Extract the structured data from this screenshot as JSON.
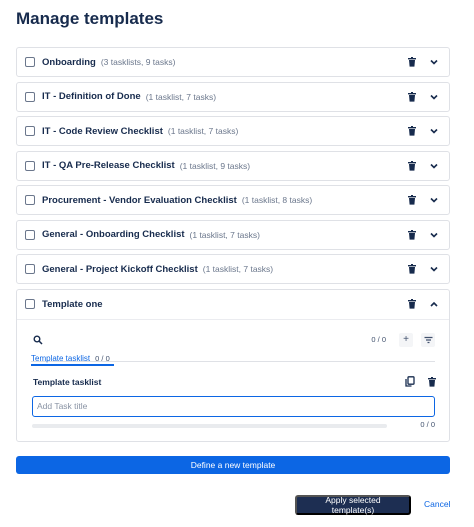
{
  "dialog": {
    "title": "Manage templates"
  },
  "templates": [
    {
      "name": "Onboarding",
      "meta": "(3 tasklists, 9 tasks)"
    },
    {
      "name": "IT - Definition of Done",
      "meta": "(1 tasklist, 7 tasks)"
    },
    {
      "name": "IT - Code Review Checklist",
      "meta": "(1 tasklist, 7 tasks)"
    },
    {
      "name": "IT - QA Pre-Release Checklist",
      "meta": "(1 tasklist, 9 tasks)"
    },
    {
      "name": "Procurement - Vendor Evaluation Checklist",
      "meta": "(1 tasklist, 8 tasks)"
    },
    {
      "name": "General - Onboarding Checklist",
      "meta": "(1 tasklist, 7 tasks)"
    },
    {
      "name": "General - Project Kickoff Checklist",
      "meta": "(1 tasklist, 7 tasks)"
    }
  ],
  "expanded_template": {
    "name": "Template one",
    "toolbar_count": "0 / 0",
    "tab": {
      "label": "Template tasklist",
      "count": "0 / 0"
    },
    "tasklist_title": "Template tasklist",
    "task_input_placeholder": "Add Task title",
    "progress": {
      "fraction": 0,
      "count": "0 / 0"
    }
  },
  "footer": {
    "define_label": "Define a new template",
    "apply_label": "Apply selected template(s)",
    "cancel_label": "Cancel"
  },
  "colors": {
    "primary": "#0c66e4",
    "apply_button": "#1d2e52",
    "text": "#172b4d",
    "muted": "#6b778c"
  },
  "icons": {
    "row_delete": "trash-icon",
    "row_expand": "chevron-down-icon",
    "row_collapse": "chevron-up-icon",
    "search": "search-icon",
    "add": "plus-icon",
    "filter": "filter-icon",
    "copy": "copy-icon"
  }
}
